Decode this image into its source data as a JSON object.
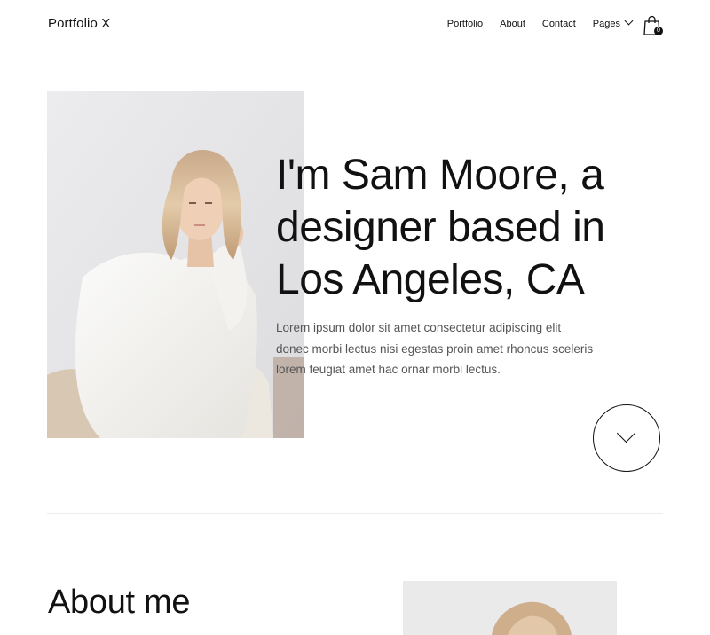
{
  "header": {
    "logo": "Portfolio X",
    "nav": [
      {
        "label": "Portfolio"
      },
      {
        "label": "About"
      },
      {
        "label": "Contact"
      },
      {
        "label": "Pages"
      }
    ],
    "cart_count": "0"
  },
  "hero": {
    "headline_lines": [
      "I'm Sam Moore, a",
      "designer based in",
      "Los Angeles, CA"
    ],
    "intro_lines": [
      "Lorem ipsum dolor sit amet consectetur adipiscing elit",
      "donec morbi lectus nisi egestas proin amet rhoncus sceleris",
      "lorem feugiat amet hac ornar morbi lectus."
    ]
  },
  "about": {
    "title": "About me"
  },
  "colors": {
    "text": "#111111",
    "body_text": "#555555",
    "divider": "#ececec",
    "background": "#ffffff"
  },
  "icons": {
    "cart": "shopping-bag-icon",
    "scroll": "chevron-down-icon",
    "dropdown": "chevron-down-icon"
  }
}
